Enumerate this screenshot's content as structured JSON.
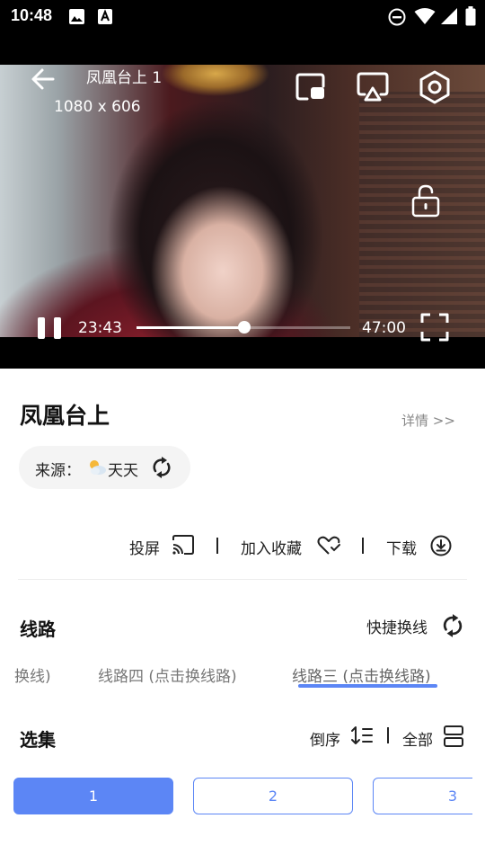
{
  "status_bar": {
    "time": "10:48",
    "icons": [
      "gallery-icon",
      "font-icon",
      "dnd-icon",
      "wifi-icon",
      "signal-icon",
      "battery-icon"
    ]
  },
  "player": {
    "title": "凤凰台上 1",
    "resolution": "1080 x 606",
    "current_time": "23:43",
    "duration": "47:00",
    "progress": 0.505
  },
  "info": {
    "title": "凤凰台上",
    "detail_link": "详情 >>",
    "source_label": "来源：",
    "source_name": "天天"
  },
  "actions": {
    "cast": "投屏",
    "favorite": "加入收藏",
    "download": "下载"
  },
  "routes": {
    "section_title": "线路",
    "quick_switch": "快捷换线",
    "tabs": [
      "换线)",
      "线路四 (点击换线路)",
      "线路三 (点击换线路)"
    ],
    "active_index": 2
  },
  "episodes": {
    "section_title": "选集",
    "sort_label": "倒序",
    "all_label": "全部",
    "items": [
      "1",
      "2",
      "3"
    ],
    "active_index": 0
  },
  "colors": {
    "accent": "#5c86f5",
    "pill_bg": "#f4f4f4"
  }
}
